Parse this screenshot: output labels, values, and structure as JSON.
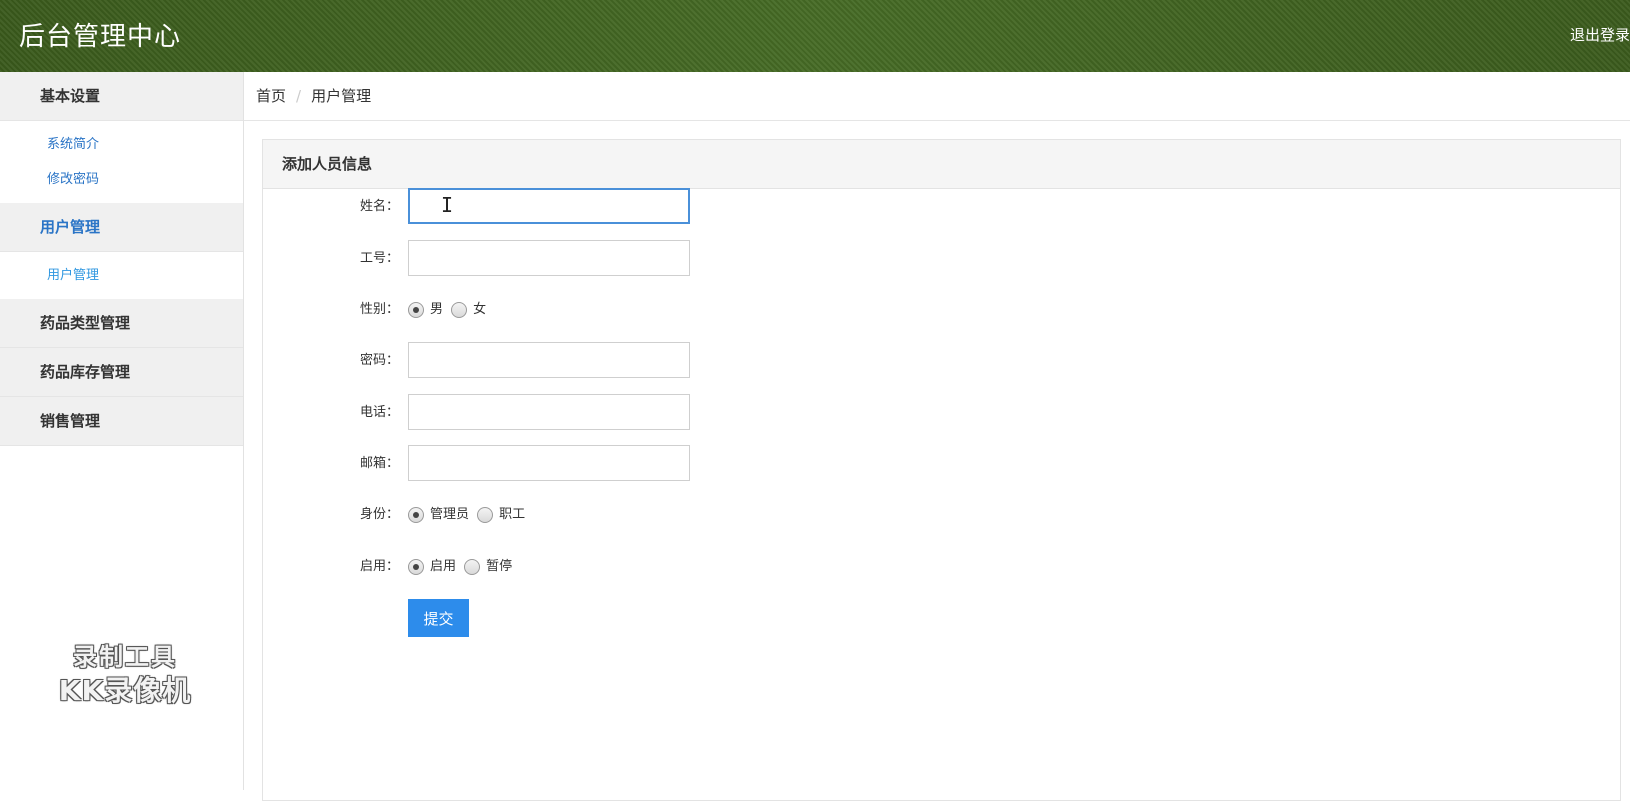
{
  "header": {
    "title": "后台管理中心",
    "logout": "退出登录"
  },
  "sidebar": {
    "groups": [
      {
        "label": "基本设置",
        "items": [
          {
            "label": "系统简介"
          },
          {
            "label": "修改密码"
          }
        ]
      },
      {
        "label": "用户管理",
        "items": [
          {
            "label": "用户管理"
          }
        ]
      },
      {
        "label": "药品类型管理"
      },
      {
        "label": "药品库存管理"
      },
      {
        "label": "销售管理"
      }
    ]
  },
  "breadcrumb": {
    "home": "首页",
    "current": "用户管理"
  },
  "form": {
    "title": "添加人员信息",
    "name_label": "姓名：",
    "name_value": "",
    "id_label": "工号：",
    "gender_label": "性别：",
    "gender_options": [
      "男",
      "女"
    ],
    "gender_selected": "男",
    "password_label": "密码：",
    "phone_label": "电话：",
    "email_label": "邮箱：",
    "role_label": "身份：",
    "role_options": [
      "管理员",
      "职工"
    ],
    "role_selected": "管理员",
    "enable_label": "启用：",
    "enable_options": [
      "启用",
      "暂停"
    ],
    "enable_selected": "启用",
    "submit": "提交"
  },
  "watermark": {
    "line1": "录制工具",
    "line2": "KK录像机"
  }
}
